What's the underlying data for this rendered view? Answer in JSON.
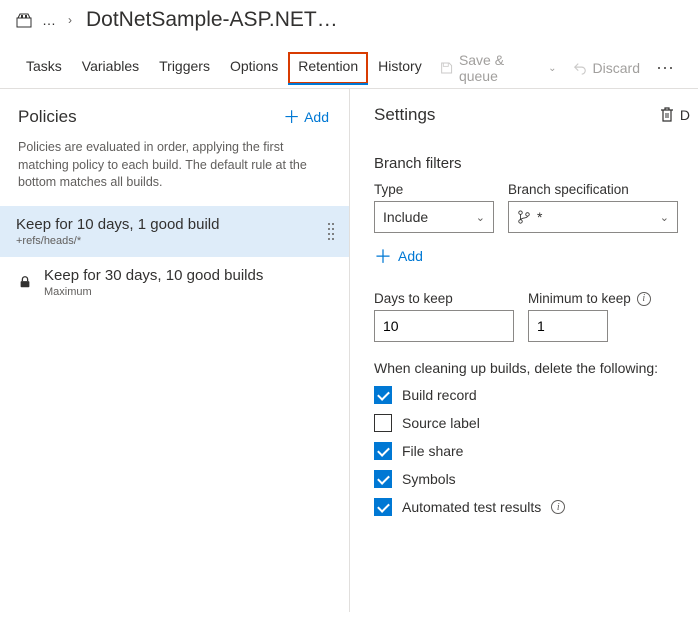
{
  "header": {
    "title": "DotNetSample-ASP.NET…"
  },
  "tabs": [
    "Tasks",
    "Variables",
    "Triggers",
    "Options",
    "Retention",
    "History"
  ],
  "toolbar": {
    "save_label": "Save & queue",
    "discard_label": "Discard"
  },
  "policies": {
    "heading": "Policies",
    "add_label": "Add",
    "description": "Policies are evaluated in order, applying the first matching policy to each build. The default rule at the bottom matches all builds.",
    "items": [
      {
        "title": "Keep for 10 days, 1 good build",
        "subtitle": "+refs/heads/*",
        "locked": false,
        "selected": true
      },
      {
        "title": "Keep for 30 days, 10 good builds",
        "subtitle": "Maximum",
        "locked": true,
        "selected": false
      }
    ]
  },
  "settings": {
    "heading": "Settings",
    "delete_label": "D",
    "branch_filters_heading": "Branch filters",
    "type_label": "Type",
    "branch_spec_label": "Branch specification",
    "type_value": "Include",
    "branch_spec_value": "*",
    "add_branch_label": "Add",
    "days_label": "Days to keep",
    "days_value": "10",
    "min_label": "Minimum to keep",
    "min_value": "1",
    "clean_label": "When cleaning up builds, delete the following:",
    "checkboxes": [
      {
        "label": "Build record",
        "checked": true,
        "info": false
      },
      {
        "label": "Source label",
        "checked": false,
        "info": false
      },
      {
        "label": "File share",
        "checked": true,
        "info": false
      },
      {
        "label": "Symbols",
        "checked": true,
        "info": false
      },
      {
        "label": "Automated test results",
        "checked": true,
        "info": true
      }
    ]
  }
}
